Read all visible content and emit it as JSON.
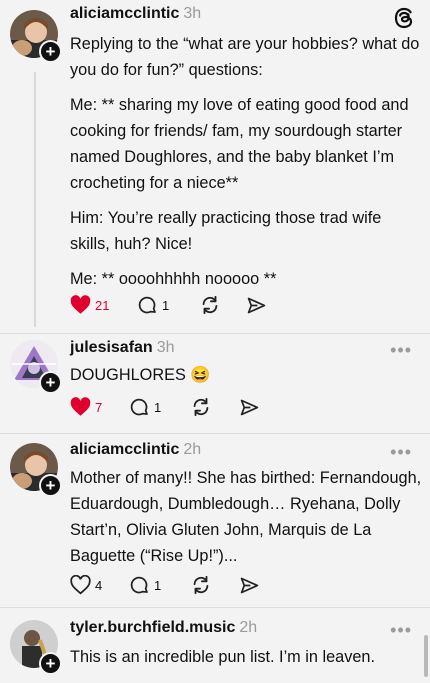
{
  "posts": [
    {
      "username": "aliciamcclintic",
      "time": "3h",
      "paragraphs": [
        "Replying to the “what are your hobbies? what do you do for fun?” questions:",
        "Me: ** sharing my love of eating good food and cooking for friends/ fam, my sourdough starter named Doughlores, and the baby blanket I’m crocheting for a niece**",
        "Him: You’re really practicing those trad wife skills, huh? Nice!",
        "Me: ** oooohhhhh nooooo **"
      ],
      "likes": "21",
      "replies": "1",
      "liked": true
    },
    {
      "username": "julesisafan",
      "time": "3h",
      "paragraphs": [
        "DOUGHLORES 😆"
      ],
      "likes": "7",
      "replies": "1",
      "liked": true
    },
    {
      "username": "aliciamcclintic",
      "time": "2h",
      "paragraphs": [
        "Mother of many!! She has birthed: Fernandough, Eduardough, Dumbledough… Ryehana, Dolly Start’n, Olivia Gluten John, Marquis de La Baguette (“Rise Up!”)..."
      ],
      "likes": "4",
      "replies": "1",
      "liked": false
    },
    {
      "username": "tyler.burchfield.music",
      "time": "2h",
      "paragraphs": [
        "This is an incredible pun list. I’m in leaven."
      ],
      "likes": "",
      "replies": "",
      "liked": false
    }
  ],
  "more_label": "•••",
  "colors": {
    "like": "#e0002f",
    "muted": "#9a9a9a",
    "background": "#f3f3f3"
  },
  "icons": [
    "threads-logo-icon",
    "heart-icon",
    "comment-icon",
    "repost-icon",
    "share-icon",
    "follow-plus-icon",
    "more-icon"
  ]
}
